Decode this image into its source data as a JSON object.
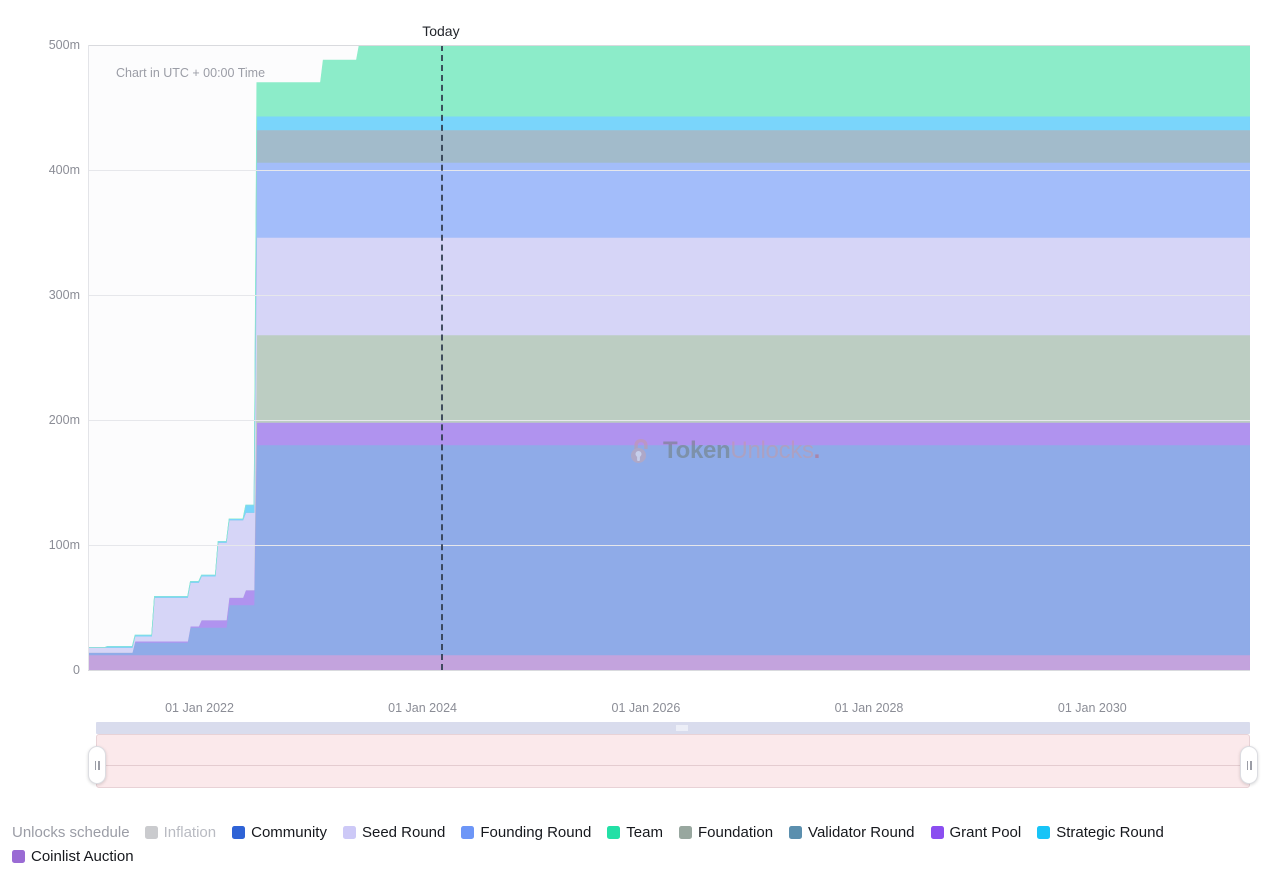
{
  "annotations": {
    "today_label": "Today",
    "utc_note": "Chart in UTC + 00:00 Time",
    "watermark_a": "Token",
    "watermark_b": "Unlocks",
    "watermark_dot": "."
  },
  "legend": {
    "title": "Unlocks schedule",
    "items": [
      {
        "label": "Inflation",
        "color": "#a6a8ad",
        "muted": true
      },
      {
        "label": "Community",
        "color": "#2f63d6",
        "muted": false
      },
      {
        "label": "Seed Round",
        "color": "#cdc9f7",
        "muted": false
      },
      {
        "label": "Founding Round",
        "color": "#6d96f7",
        "muted": false
      },
      {
        "label": "Team",
        "color": "#23e0a6",
        "muted": false
      },
      {
        "label": "Foundation",
        "color": "#98a79f",
        "muted": false
      },
      {
        "label": "Validator Round",
        "color": "#5b8fae",
        "muted": false
      },
      {
        "label": "Grant Pool",
        "color": "#8b4ef0",
        "muted": false
      },
      {
        "label": "Strategic Round",
        "color": "#18c4f7",
        "muted": false
      },
      {
        "label": "Coinlist Auction",
        "color": "#9a6bd4",
        "muted": false
      }
    ]
  },
  "slider": {
    "left_handle_icon": "drag-grip",
    "right_handle_icon": "drag-grip"
  },
  "chart_data": {
    "type": "area",
    "title": "",
    "xlabel": "",
    "ylabel": "",
    "stacked": true,
    "grid": true,
    "legend_position": "bottom",
    "ylim": [
      0,
      500000000
    ],
    "ytick_labels": [
      "0",
      "100m",
      "200m",
      "300m",
      "400m",
      "500m"
    ],
    "ytick_values": [
      0,
      100000000,
      200000000,
      300000000,
      400000000,
      500000000
    ],
    "xtick_labels": [
      "01 Jan 2022",
      "01 Jan 2024",
      "01 Jan 2026",
      "01 Jan 2028",
      "01 Jan 2030"
    ],
    "x_range": [
      "2021-01-01",
      "2031-06-01"
    ],
    "today_x": "2024-03-01",
    "total_supply_final": 500000000,
    "note": "Stacked cumulative token unlock schedule. Values in millions of tokens at final (fully unlocked) state; early period ramps in steps from 2021 with a large cliff in mid-2022.",
    "series": [
      {
        "name": "Coinlist Auction",
        "color": "#c3a3dd",
        "final_value": 12000000,
        "points": [
          {
            "x": "2021-01-01",
            "y": 12000000
          },
          {
            "x": "2031-06-01",
            "y": 12000000
          }
        ]
      },
      {
        "name": "Community",
        "color": "#8fabe8",
        "final_value": 168000000,
        "points": [
          {
            "x": "2021-01-01",
            "y": 2000000
          },
          {
            "x": "2021-06-01",
            "y": 10000000
          },
          {
            "x": "2021-12-01",
            "y": 22000000
          },
          {
            "x": "2022-04-01",
            "y": 40000000
          },
          {
            "x": "2022-07-01",
            "y": 168000000
          },
          {
            "x": "2031-06-01",
            "y": 168000000
          }
        ]
      },
      {
        "name": "Grant Pool",
        "color": "#b093ef",
        "final_value": 18000000,
        "points": [
          {
            "x": "2021-06-01",
            "y": 1000000
          },
          {
            "x": "2022-01-01",
            "y": 6000000
          },
          {
            "x": "2022-06-01",
            "y": 12000000
          },
          {
            "x": "2022-07-01",
            "y": 18000000
          },
          {
            "x": "2031-06-01",
            "y": 18000000
          }
        ]
      },
      {
        "name": "Foundation",
        "color": "#bccdc2",
        "final_value": 70000000,
        "points": [
          {
            "x": "2022-07-01",
            "y": 70000000
          },
          {
            "x": "2031-06-01",
            "y": 70000000
          }
        ]
      },
      {
        "name": "Seed Round",
        "color": "#d6d5f7",
        "final_value": 78000000,
        "points": [
          {
            "x": "2021-01-01",
            "y": 4000000
          },
          {
            "x": "2021-08-01",
            "y": 35000000
          },
          {
            "x": "2022-03-01",
            "y": 62000000
          },
          {
            "x": "2022-07-01",
            "y": 78000000
          },
          {
            "x": "2031-06-01",
            "y": 78000000
          }
        ]
      },
      {
        "name": "Founding Round",
        "color": "#a3bdfa",
        "final_value": 60000000,
        "points": [
          {
            "x": "2022-07-01",
            "y": 60000000
          },
          {
            "x": "2031-06-01",
            "y": 60000000
          }
        ]
      },
      {
        "name": "Validator Round",
        "color": "#a2bbcb",
        "final_value": 26000000,
        "points": [
          {
            "x": "2022-07-01",
            "y": 26000000
          },
          {
            "x": "2031-06-01",
            "y": 26000000
          }
        ]
      },
      {
        "name": "Strategic Round",
        "color": "#7ad5fb",
        "final_value": 11000000,
        "points": [
          {
            "x": "2021-03-01",
            "y": 1000000
          },
          {
            "x": "2022-06-01",
            "y": 6000000
          },
          {
            "x": "2022-07-01",
            "y": 11000000
          },
          {
            "x": "2031-06-01",
            "y": 11000000
          }
        ]
      },
      {
        "name": "Team",
        "color": "#8cecc9",
        "final_value": 57000000,
        "points": [
          {
            "x": "2022-07-01",
            "y": 27000000
          },
          {
            "x": "2023-02-01",
            "y": 45000000
          },
          {
            "x": "2023-06-01",
            "y": 57000000
          },
          {
            "x": "2031-06-01",
            "y": 57000000
          }
        ]
      }
    ]
  }
}
